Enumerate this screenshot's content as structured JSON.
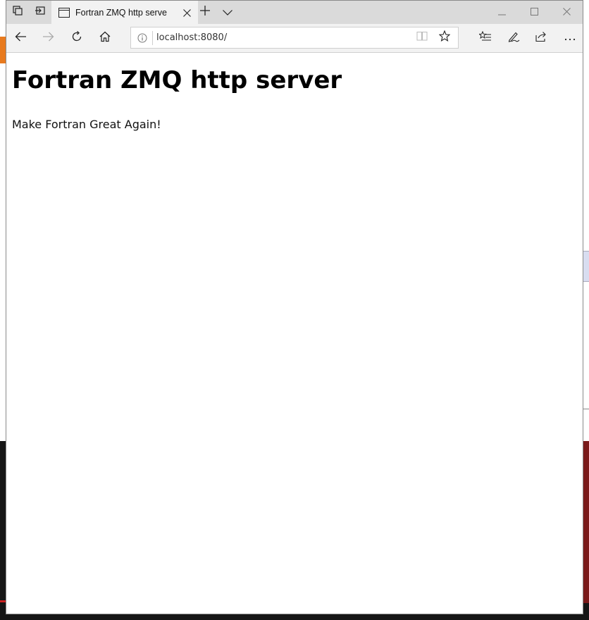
{
  "browser": {
    "tab": {
      "title": "Fortran ZMQ http serve"
    },
    "address": {
      "url": "localhost:8080/"
    }
  },
  "page": {
    "heading": "Fortran ZMQ http server",
    "paragraph": "Make Fortran Great Again!"
  },
  "icons": {
    "tab_actions": "tab-actions-icon",
    "set_aside": "set-aside-tabs-icon",
    "tab_page": "page-icon",
    "tab_close": "close-icon",
    "new_tab": "plus-icon",
    "tab_preview": "chevron-down-icon",
    "minimize": "minimize-icon",
    "maximize": "maximize-icon",
    "close_window": "close-icon",
    "back": "back-arrow-icon",
    "forward": "forward-arrow-icon",
    "refresh": "refresh-icon",
    "home": "home-icon",
    "site_info": "info-icon",
    "reading_view": "book-icon",
    "favorite": "star-icon",
    "favorites_hub": "favorites-list-icon",
    "notes": "pen-icon",
    "share": "share-icon",
    "more": "more-icon"
  },
  "colors": {
    "titlebar": "#dadada",
    "toolbar": "#f2f2f2",
    "page_background": "#ffffff"
  }
}
